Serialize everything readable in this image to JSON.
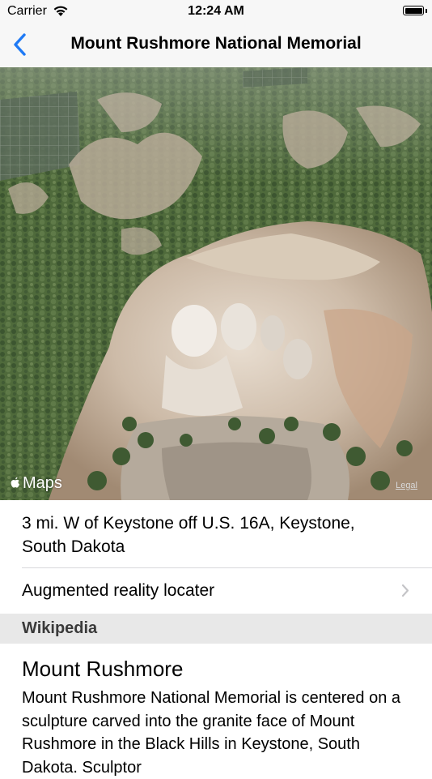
{
  "status_bar": {
    "carrier": "Carrier",
    "time": "12:24 AM",
    "battery_level": 1.0
  },
  "nav_bar": {
    "title": "Mount Rushmore National Memorial",
    "back_icon": "chevron-left-icon",
    "accent_color": "#1f7af5"
  },
  "map": {
    "attribution": "Maps",
    "legal_label": "Legal"
  },
  "address": {
    "text": "3 mi. W of Keystone off U.S. 16A, Keystone, South Dakota"
  },
  "ar_row": {
    "label": "Augmented reality locater",
    "chevron_icon": "chevron-right-icon"
  },
  "wikipedia": {
    "section_title": "Wikipedia",
    "article_title": "Mount Rushmore",
    "article_body": "Mount Rushmore National Memorial is centered on a sculpture carved into the granite face of Mount Rushmore in the Black Hills in Keystone, South Dakota. Sculptor"
  }
}
